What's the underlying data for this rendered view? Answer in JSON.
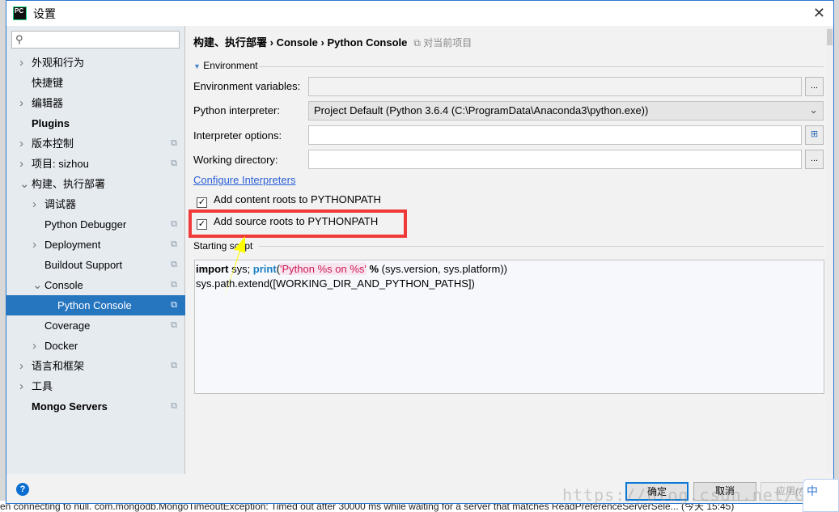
{
  "window": {
    "title": "设置",
    "logo": "PC"
  },
  "search": {
    "placeholder": ""
  },
  "sidebar": {
    "items": [
      {
        "label": "外观和行为",
        "level": 0,
        "arrow": "right",
        "bold": false,
        "copy": false
      },
      {
        "label": "快捷键",
        "level": 0,
        "arrow": "",
        "bold": false,
        "copy": false
      },
      {
        "label": "编辑器",
        "level": 0,
        "arrow": "right",
        "bold": false,
        "copy": false
      },
      {
        "label": "Plugins",
        "level": 0,
        "arrow": "",
        "bold": true,
        "copy": false
      },
      {
        "label": "版本控制",
        "level": 0,
        "arrow": "right",
        "bold": false,
        "copy": true
      },
      {
        "label": "项目: sizhou",
        "level": 0,
        "arrow": "right",
        "bold": false,
        "copy": true
      },
      {
        "label": "构建、执行部署",
        "level": 0,
        "arrow": "down",
        "bold": false,
        "copy": false
      },
      {
        "label": "调试器",
        "level": 1,
        "arrow": "right",
        "bold": false,
        "copy": false
      },
      {
        "label": "Python Debugger",
        "level": 1,
        "arrow": "",
        "bold": false,
        "copy": true
      },
      {
        "label": "Deployment",
        "level": 1,
        "arrow": "right",
        "bold": false,
        "copy": true
      },
      {
        "label": "Buildout Support",
        "level": 1,
        "arrow": "",
        "bold": false,
        "copy": true
      },
      {
        "label": "Console",
        "level": 1,
        "arrow": "down",
        "bold": false,
        "copy": true
      },
      {
        "label": "Python Console",
        "level": 2,
        "arrow": "",
        "bold": false,
        "copy": true,
        "selected": true
      },
      {
        "label": "Coverage",
        "level": 1,
        "arrow": "",
        "bold": false,
        "copy": true
      },
      {
        "label": "Docker",
        "level": 1,
        "arrow": "right",
        "bold": false,
        "copy": false
      },
      {
        "label": "语言和框架",
        "level": 0,
        "arrow": "right",
        "bold": false,
        "copy": true
      },
      {
        "label": "工具",
        "level": 0,
        "arrow": "right",
        "bold": false,
        "copy": false
      },
      {
        "label": "Mongo Servers",
        "level": 0,
        "arrow": "",
        "bold": true,
        "copy": true
      }
    ]
  },
  "breadcrumb": {
    "parts": [
      "构建、执行部署",
      "Console",
      "Python Console"
    ],
    "scope": "对当前项目"
  },
  "environment": {
    "section": "Environment",
    "env_vars_label": "Environment variables:",
    "env_vars_value": "",
    "interpreter_label": "Python interpreter:",
    "interpreter_value": "Project Default (Python 3.6.4 (C:\\ProgramData\\Anaconda3\\python.exe))",
    "options_label": "Interpreter options:",
    "options_value": "",
    "workdir_label": "Working directory:",
    "workdir_value": "",
    "configure_link": "Configure Interpreters",
    "content_roots": {
      "label": "Add content roots to PYTHONPATH",
      "checked": true
    },
    "source_roots": {
      "label": "Add source roots to PYTHONPATH",
      "checked": true
    },
    "browse": "..."
  },
  "script": {
    "label": "Starting script",
    "l1_kw": "import",
    "l1_a": " sys; ",
    "l1_fn": "print",
    "l1_b": "(",
    "l1_str": "'Python %s on %s'",
    "l1_op": " %",
    "l1_c": " (sys.version, sys.platform))",
    "line2": "sys.path.extend([WORKING_DIR_AND_PYTHON_PATHS])"
  },
  "footer": {
    "ok": "确定",
    "cancel": "取消",
    "apply": "应用(A)",
    "help": "?"
  },
  "background": {
    "log": "en connecting to null. com.mongodb.MongoTimeoutException: Timed out after 30000 ms while waiting for a server that matches ReadPreferenceServerSele... (今天 15:45)",
    "ime": "中"
  },
  "watermark": "https://blog.csdn.net/Gdewo3ea0",
  "colors": {
    "selection": "#2675bf",
    "annotation": "#f03a3a",
    "arrow": "#ffff00",
    "link": "#2a5fd6"
  }
}
